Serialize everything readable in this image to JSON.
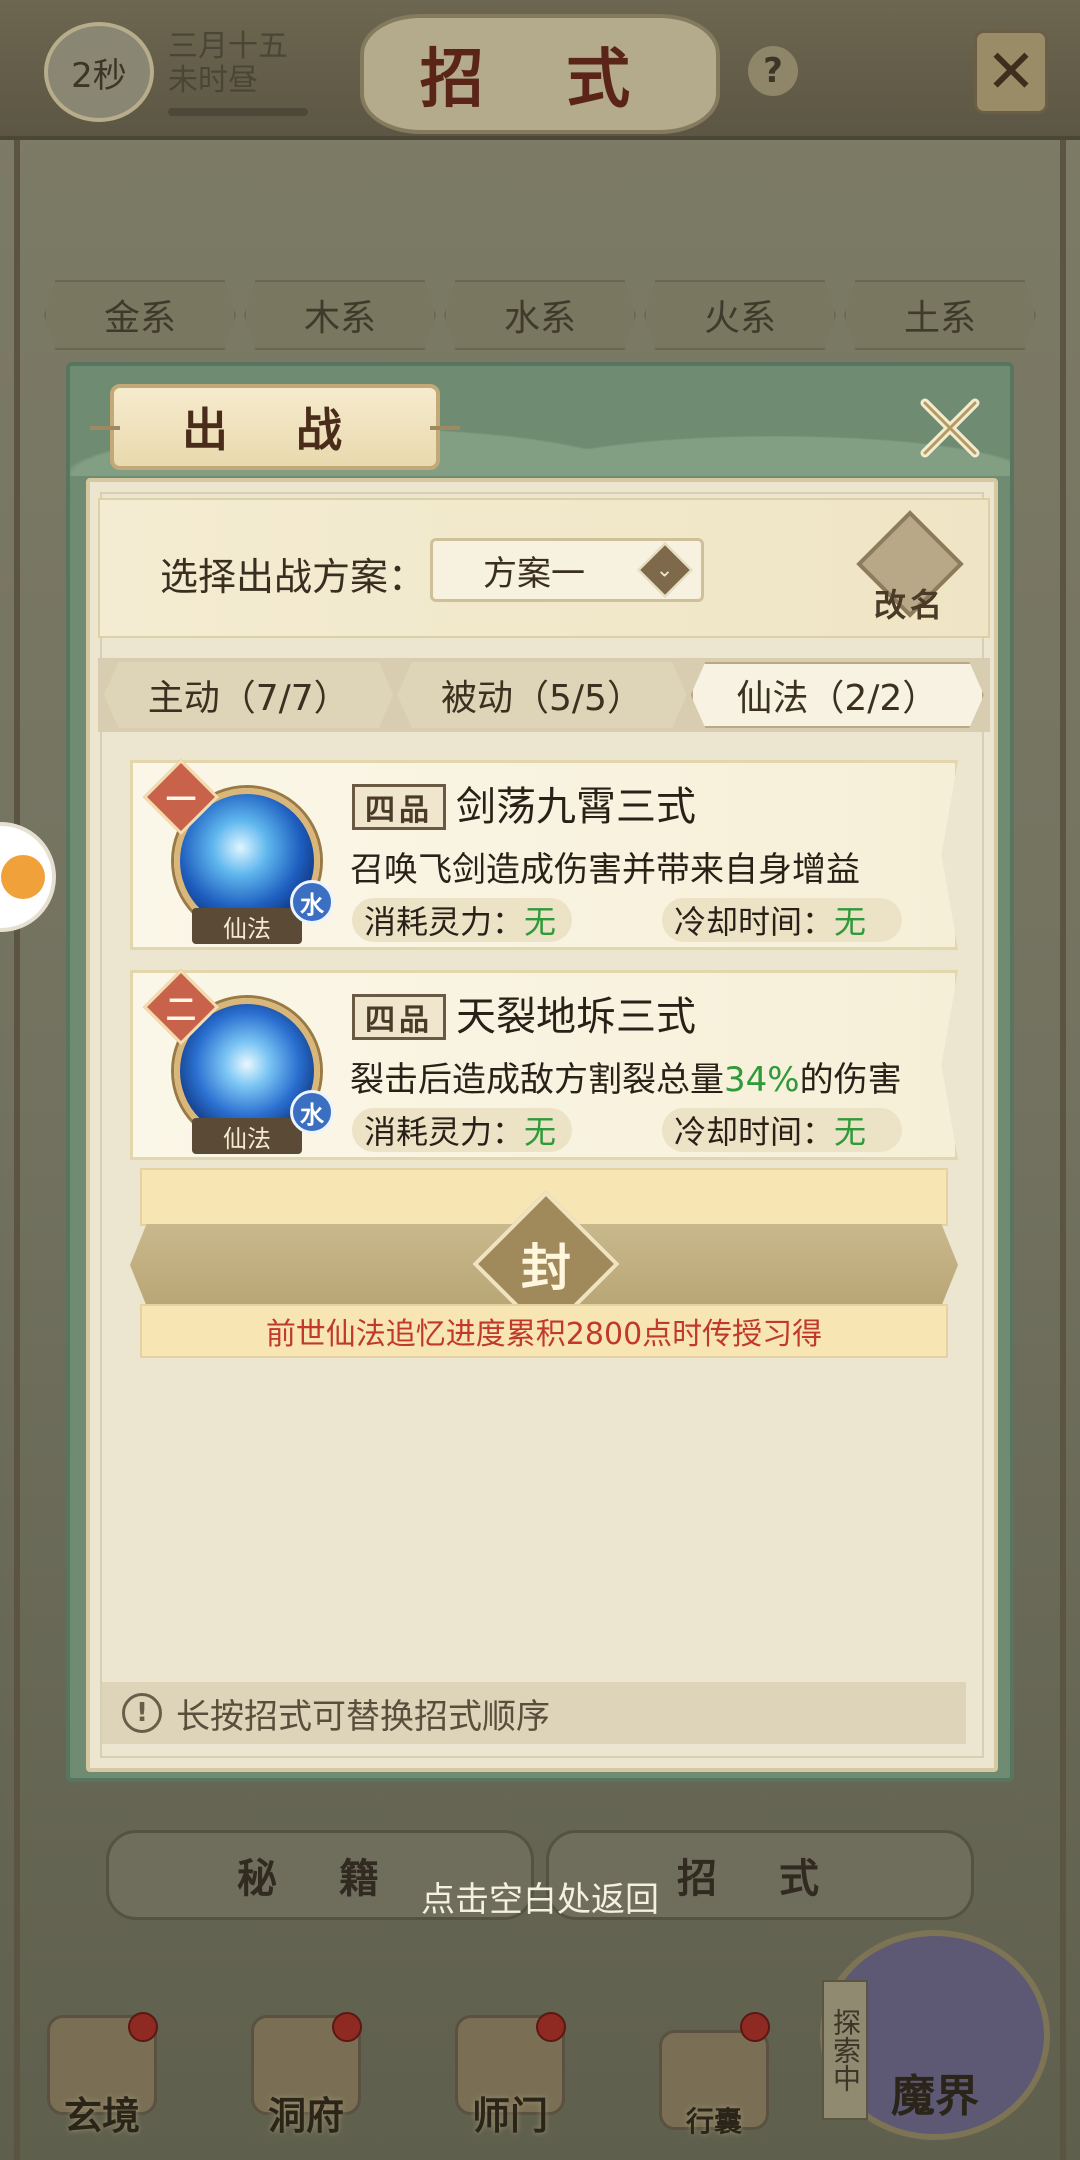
{
  "status": {
    "timer": "2秒",
    "date_line1": "三月十五",
    "date_line2": "未时昼"
  },
  "header": {
    "title": "招 式",
    "help": "?"
  },
  "element_tabs": [
    "金系",
    "木系",
    "水系",
    "火系",
    "土系"
  ],
  "modal": {
    "title": "出 战",
    "plan": {
      "label": "选择出战方案：",
      "selected": "方案一",
      "rename": "改名"
    },
    "tabs": [
      {
        "label": "主动（7/7）"
      },
      {
        "label": "被动（5/5）"
      },
      {
        "label": "仙法（2/2）",
        "active": true
      }
    ],
    "skills": [
      {
        "rank": "一",
        "grade": "四品",
        "name": "剑荡九霄三式",
        "desc_pre": "召唤飞剑造成伤害并带来自身增益",
        "desc_hl": "",
        "desc_post": "",
        "type_tag": "仙法",
        "element": "水",
        "cost_label": "消耗灵力：",
        "cost_value": "无",
        "cd_label": "冷却时间：",
        "cd_value": "无"
      },
      {
        "rank": "二",
        "grade": "四品",
        "name": "天裂地坼三式",
        "desc_pre": "裂击后造成敌方割裂总量",
        "desc_hl": "34%",
        "desc_post": "的伤害",
        "type_tag": "仙法",
        "element": "水",
        "cost_label": "消耗灵力：",
        "cost_value": "无",
        "cd_label": "冷却时间：",
        "cd_value": "无"
      }
    ],
    "locked_slot": {
      "seal": "封",
      "text": "前世仙法追忆进度累积2800点时传授习得"
    },
    "hint": "长按招式可替换招式顺序"
  },
  "bottom_tabs": [
    "秘 籍",
    "招 式"
  ],
  "return_hint": "点击空白处返回",
  "nav": {
    "items": [
      "玄境",
      "洞府",
      "师门",
      "行囊"
    ],
    "explore_tag": "探索中",
    "explore_label": "魔界"
  },
  "colors": {
    "highlight": "#2f9a3a",
    "locked_text": "#c0392b",
    "modal_bg": "#6f8c72"
  }
}
